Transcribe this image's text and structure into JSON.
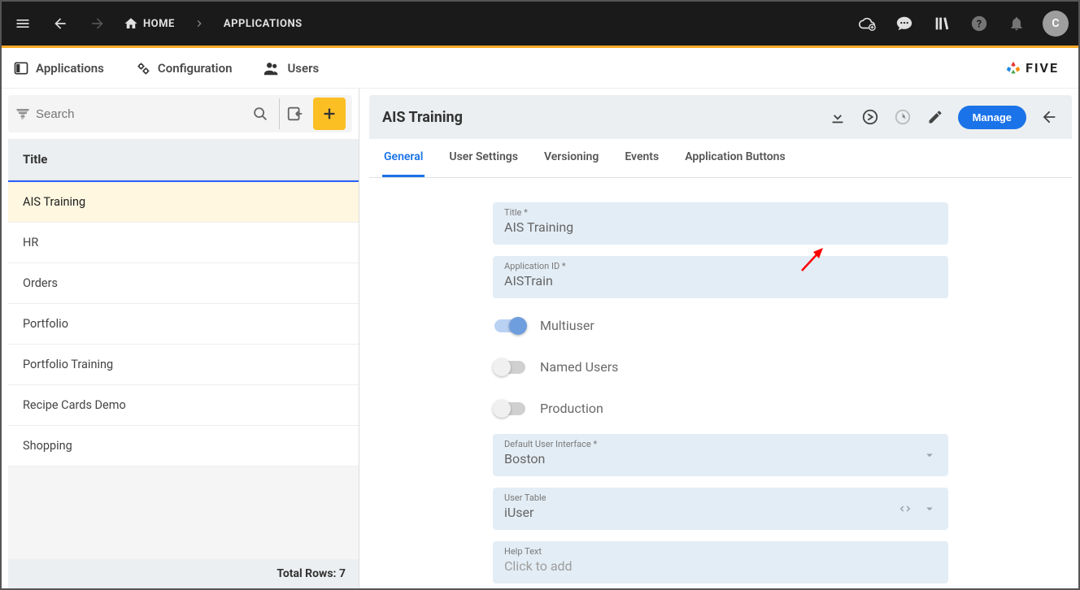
{
  "topbar": {
    "home_label": "HOME",
    "applications_label": "APPLICATIONS",
    "avatar_initial": "C"
  },
  "secnav": {
    "applications": "Applications",
    "configuration": "Configuration",
    "users": "Users",
    "logo": "FIVE"
  },
  "sidebar": {
    "search_placeholder": "Search",
    "column_header": "Title",
    "rows": [
      "AIS Training",
      "HR",
      "Orders",
      "Portfolio",
      "Portfolio Training",
      "Recipe Cards Demo",
      "Shopping"
    ],
    "footer_label": "Total Rows:",
    "footer_count": "7"
  },
  "detail": {
    "title": "AIS Training",
    "manage_label": "Manage",
    "tabs": [
      "General",
      "User Settings",
      "Versioning",
      "Events",
      "Application Buttons"
    ],
    "fields": {
      "title": {
        "label": "Title *",
        "value": "AIS Training"
      },
      "app_id": {
        "label": "Application ID *",
        "value": "AISTrain"
      },
      "multiuser": {
        "label": "Multiuser",
        "on": true
      },
      "named_users": {
        "label": "Named Users",
        "on": false
      },
      "production": {
        "label": "Production",
        "on": false
      },
      "default_ui": {
        "label": "Default User Interface *",
        "value": "Boston"
      },
      "user_table": {
        "label": "User Table",
        "value": "iUser"
      },
      "help_text": {
        "label": "Help Text",
        "placeholder": "Click to add"
      }
    }
  }
}
